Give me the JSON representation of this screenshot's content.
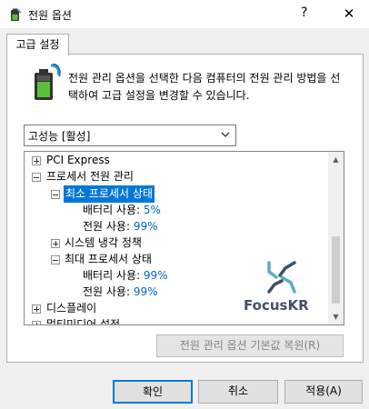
{
  "window": {
    "title": "전원 옵션",
    "help": "?",
    "close": "✕"
  },
  "tab": {
    "label": "고급 설정"
  },
  "description": "전원 관리 옵션을 선택한 다음 컴퓨터의 전원 관리 방법을 선택하여 고급 설정을 변경할 수 있습니다.",
  "plan": {
    "selected": "고성능 [활성]"
  },
  "tree": {
    "pci": "PCI Express",
    "cpu_power": "프로세서 전원 관리",
    "min_state": "최소 프로세서 상태",
    "min_battery_label": "배터리 사용:",
    "min_battery_value": "5%",
    "min_plugged_label": "전원 사용:",
    "min_plugged_value": "99%",
    "cooling": "시스템 냉각 정책",
    "max_state": "최대 프로세서 상태",
    "max_battery_label": "배터리 사용:",
    "max_battery_value": "99%",
    "max_plugged_label": "전원 사용:",
    "max_plugged_value": "99%",
    "display": "디스플레이",
    "multimedia": "멀티미디어 설정"
  },
  "watermark": {
    "text": "FocusKR"
  },
  "buttons": {
    "restore": "전원 관리 옵션 기본값 복원(R)",
    "ok": "확인",
    "cancel": "취소",
    "apply": "적용(A)"
  },
  "colors": {
    "selection": "#0078d7",
    "value_blue": "#0066cc",
    "accent": "#0078d7"
  }
}
